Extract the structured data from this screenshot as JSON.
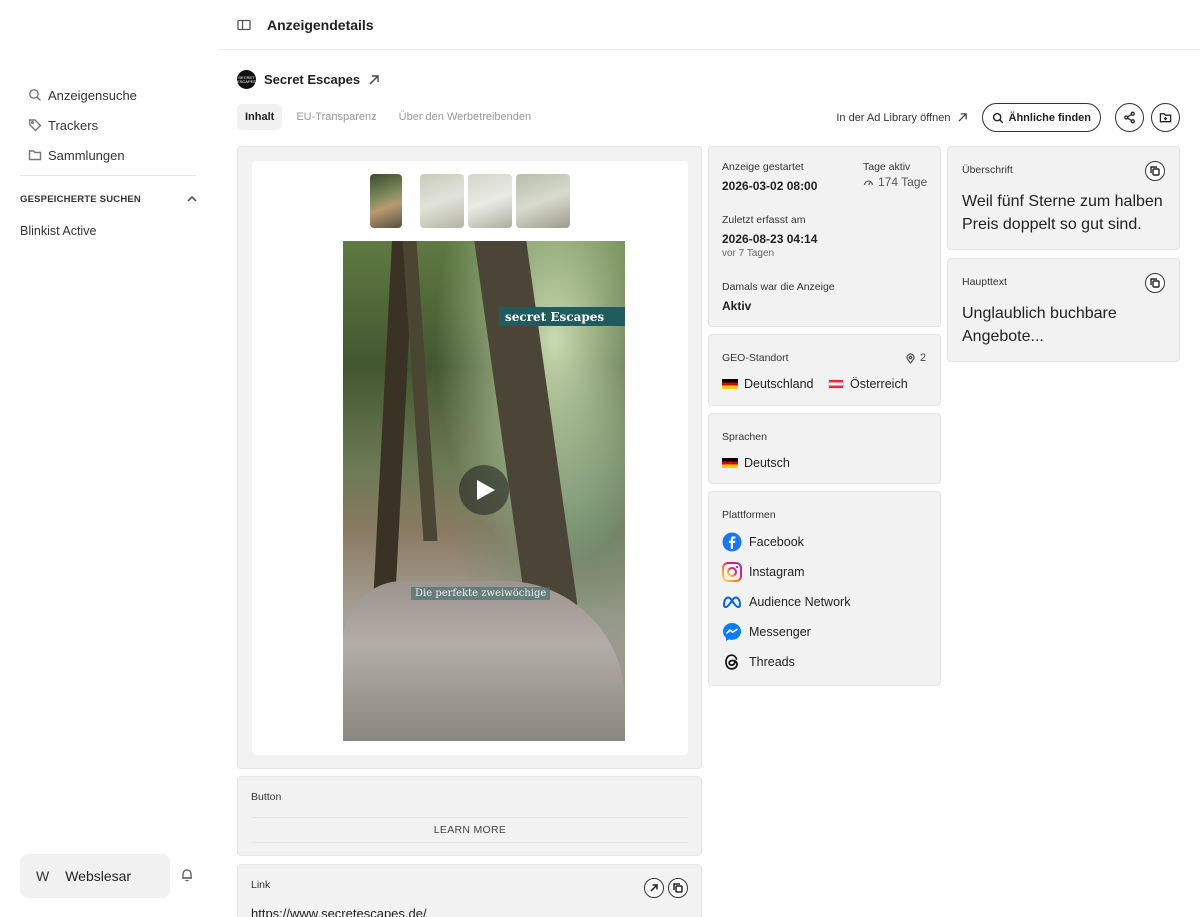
{
  "sidebar": {
    "nav": [
      {
        "label": "Anzeigensuche",
        "icon": "search-icon"
      },
      {
        "label": "Trackers",
        "icon": "tag-icon"
      },
      {
        "label": "Sammlungen",
        "icon": "folder-icon"
      }
    ],
    "saved_title": "GESPEICHERTE SUCHEN",
    "saved_items": [
      "Blinkist Active"
    ],
    "user": {
      "initial": "W",
      "name": "Webslesar"
    }
  },
  "header": {
    "title": "Anzeigendetails"
  },
  "advertiser": {
    "name": "Secret Escapes",
    "logo_text": "SECRET ESCAPES"
  },
  "tabs": [
    {
      "label": "Inhalt",
      "active": true
    },
    {
      "label": "EU-Transparenz",
      "active": false
    },
    {
      "label": "Über den Werbetreibenden",
      "active": false
    }
  ],
  "actions": {
    "ad_library": "In der Ad Library öffnen",
    "similar": "Ähnliche finden"
  },
  "media": {
    "brand_overlay": "secret Escapes",
    "caption": "Die perfekte zweiwöchige",
    "thumbnail_count": 4
  },
  "button_card": {
    "label": "Button",
    "cta": "LEARN MORE"
  },
  "link_card": {
    "label": "Link",
    "url": "https://www.secretescapes.de/"
  },
  "info": {
    "started_label": "Anzeige gestartet",
    "started_value": "2026-03-02 08:00",
    "days_label": "Tage aktiv",
    "days_value": "174 Tage",
    "last_seen_label": "Zuletzt erfasst am",
    "last_seen_value": "2026-08-23 04:14",
    "last_seen_ago": "vor 7 Tagen",
    "status_label": "Damals war die Anzeige",
    "status_value": "Aktiv"
  },
  "geo": {
    "label": "GEO-Standort",
    "count": "2",
    "countries": [
      "Deutschland",
      "Österreich"
    ]
  },
  "languages": {
    "label": "Sprachen",
    "items": [
      "Deutsch"
    ]
  },
  "platforms": {
    "label": "Plattformen",
    "items": [
      "Facebook",
      "Instagram",
      "Audience Network",
      "Messenger",
      "Threads"
    ]
  },
  "headline": {
    "label": "Überschrift",
    "text": "Weil fünf Sterne zum halben Preis doppelt so gut sind."
  },
  "body": {
    "label": "Haupttext",
    "text": "Unglaublich buchbare Angebote..."
  },
  "colors": {
    "card_bg": "#f2f2f2",
    "facebook": "#1877f2",
    "messenger": "#0a7cff",
    "meta": "#0467df",
    "brand_banner": "#1f5c5e"
  }
}
